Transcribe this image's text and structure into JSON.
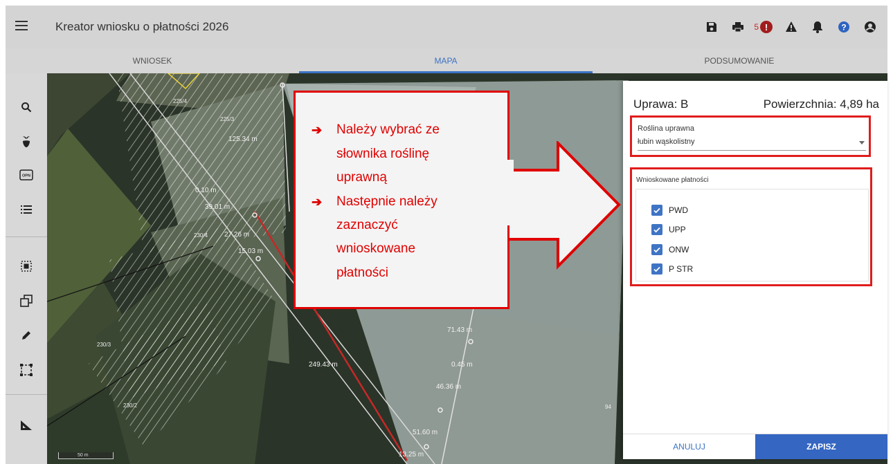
{
  "header": {
    "title": "Kreator wniosku o płatności 2026",
    "error_count": "5",
    "error_icon_text": "!",
    "icons": [
      "menu-icon",
      "save-icon",
      "print-icon",
      "error-icon",
      "warning-icon",
      "bell-icon",
      "help-icon",
      "account-icon"
    ]
  },
  "tabs": [
    {
      "label": "WNIOSEK"
    },
    {
      "label": "MAPA"
    },
    {
      "label": "PODSUMOWANIE"
    }
  ],
  "toolbar": {
    "icons": [
      "search-icon",
      "plant-icon",
      "opn-icon",
      "list-icon",
      "select-icon",
      "copy-icon",
      "pencil-icon",
      "bounding-box-icon",
      "measure-icon"
    ],
    "opn_text": "OPN"
  },
  "map": {
    "parcel_labels": [
      "225/4",
      "225/3",
      "230/4",
      "230/3",
      "230/2",
      "94"
    ],
    "measurements": [
      "125.34 m",
      "0.10 m",
      "39.01 m",
      "27.26 m",
      "15.03 m",
      "71.43 m",
      "249.43 m",
      "0.45 m",
      "46.36 m",
      "51.60 m",
      "13.25 m"
    ],
    "scale_label": "50 m"
  },
  "callout": {
    "arrow_glyph": "➔",
    "lines": [
      "Należy wybrać ze",
      "słownika roślinę",
      "uprawną",
      "Następnie należy",
      "zaznaczyć",
      "wnioskowane",
      "płatności"
    ]
  },
  "panel": {
    "crop_label": "Uprawa: B",
    "area_label": "Powierzchnia: 4,89 ha",
    "plant_field_label": "Roślina uprawna",
    "plant_field_value": "łubin wąskolistny",
    "payments_title": "Wnioskowane płatności",
    "payments": [
      {
        "label": "PWD",
        "checked": true
      },
      {
        "label": "UPP",
        "checked": true
      },
      {
        "label": "ONW",
        "checked": true
      },
      {
        "label": "P STR",
        "checked": true
      }
    ],
    "cancel_label": "ANULUJ",
    "save_label": "ZAPISZ"
  },
  "colors": {
    "accent": "#3b73c4",
    "save_button": "#3466c2",
    "callout_red": "#e00000",
    "error_badge": "#a11d1d"
  }
}
